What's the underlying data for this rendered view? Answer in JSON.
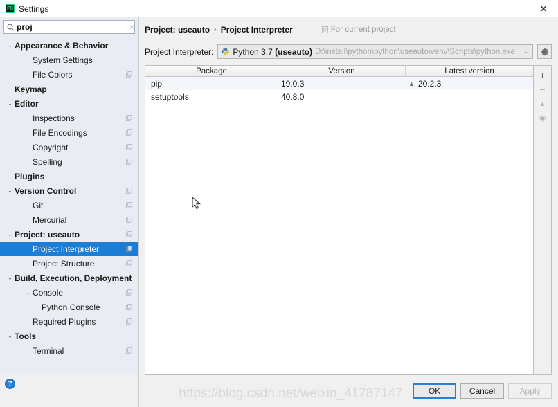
{
  "window": {
    "title": "Settings",
    "app_icon": "PC",
    "close_label": "✕"
  },
  "search": {
    "value": "proj",
    "placeholder": "",
    "clear_label": "×",
    "icon": "search-icon"
  },
  "sidebar": {
    "items": [
      {
        "label": "Appearance & Behavior",
        "depth": 0,
        "bold": true,
        "arrow": "⌄",
        "copy": false,
        "selected": false
      },
      {
        "label": "System Settings",
        "depth": 1,
        "bold": false,
        "arrow": "",
        "copy": false,
        "selected": false
      },
      {
        "label": "File Colors",
        "depth": 1,
        "bold": false,
        "arrow": "",
        "copy": true,
        "selected": false
      },
      {
        "label": "Keymap",
        "depth": 0,
        "bold": true,
        "arrow": "",
        "copy": false,
        "selected": false
      },
      {
        "label": "Editor",
        "depth": 0,
        "bold": true,
        "arrow": "⌄",
        "copy": false,
        "selected": false
      },
      {
        "label": "Inspections",
        "depth": 1,
        "bold": false,
        "arrow": "",
        "copy": true,
        "selected": false
      },
      {
        "label": "File Encodings",
        "depth": 1,
        "bold": false,
        "arrow": "",
        "copy": true,
        "selected": false
      },
      {
        "label": "Copyright",
        "depth": 1,
        "bold": false,
        "arrow": "",
        "copy": true,
        "selected": false
      },
      {
        "label": "Spelling",
        "depth": 1,
        "bold": false,
        "arrow": "",
        "copy": true,
        "selected": false
      },
      {
        "label": "Plugins",
        "depth": 0,
        "bold": true,
        "arrow": "",
        "copy": false,
        "selected": false
      },
      {
        "label": "Version Control",
        "depth": 0,
        "bold": true,
        "arrow": "⌄",
        "copy": true,
        "selected": false
      },
      {
        "label": "Git",
        "depth": 1,
        "bold": false,
        "arrow": "",
        "copy": true,
        "selected": false
      },
      {
        "label": "Mercurial",
        "depth": 1,
        "bold": false,
        "arrow": "",
        "copy": true,
        "selected": false
      },
      {
        "label": "Project: useauto",
        "depth": 0,
        "bold": true,
        "arrow": "⌄",
        "copy": true,
        "selected": false
      },
      {
        "label": "Project Interpreter",
        "depth": 1,
        "bold": false,
        "arrow": "",
        "copy": true,
        "selected": true
      },
      {
        "label": "Project Structure",
        "depth": 1,
        "bold": false,
        "arrow": "",
        "copy": true,
        "selected": false
      },
      {
        "label": "Build, Execution, Deployment",
        "depth": 0,
        "bold": true,
        "arrow": "⌄",
        "copy": false,
        "selected": false
      },
      {
        "label": "Console",
        "depth": 1,
        "bold": false,
        "arrow": "⌄",
        "copy": true,
        "selected": false
      },
      {
        "label": "Python Console",
        "depth": 2,
        "bold": false,
        "arrow": "",
        "copy": true,
        "selected": false
      },
      {
        "label": "Required Plugins",
        "depth": 1,
        "bold": false,
        "arrow": "",
        "copy": true,
        "selected": false
      },
      {
        "label": "Tools",
        "depth": 0,
        "bold": true,
        "arrow": "⌄",
        "copy": false,
        "selected": false
      },
      {
        "label": "Terminal",
        "depth": 1,
        "bold": false,
        "arrow": "",
        "copy": true,
        "selected": false
      }
    ],
    "help_label": "?"
  },
  "main": {
    "breadcrumb": {
      "parent": "Project: useauto",
      "separator": "›",
      "current": "Project Interpreter",
      "note": "For current project"
    },
    "interpreter": {
      "label": "Project Interpreter:",
      "name": "Python 3.7 (useauto)",
      "name_prefix": "Python 3.7 ",
      "name_project": "(useauto)",
      "path": "D:\\install\\python\\python\\useauto\\venv\\Scripts\\python.exe",
      "dropdown_arrow": "⌄",
      "gear_icon": "gear-icon"
    },
    "table": {
      "columns": [
        "Package",
        "Version",
        "Latest version"
      ],
      "rows": [
        {
          "package": "pip",
          "version": "19.0.3",
          "latest": "20.2.3",
          "upgradable": true
        },
        {
          "package": "setuptools",
          "version": "40.8.0",
          "latest": "",
          "upgradable": false
        }
      ],
      "side_buttons": [
        {
          "name": "add-package-button",
          "glyph": "+",
          "dim": false
        },
        {
          "name": "remove-package-button",
          "glyph": "−",
          "dim": true
        },
        {
          "name": "upgrade-package-button",
          "glyph": "▲",
          "dim": true
        },
        {
          "name": "show-early-releases-button",
          "glyph": "◉",
          "dim": true
        }
      ],
      "upgrade_marker": "▲"
    }
  },
  "footer": {
    "ok_label": "OK",
    "cancel_label": "Cancel",
    "apply_label": "Apply"
  },
  "watermark": {
    "text": "https://blog.csdn.net/weixin_41787147"
  },
  "colors": {
    "accent": "#1a7ed6",
    "sidebar_bg": "#e9edf3",
    "selection_bg": "#1a7ed6",
    "default_button_border": "#2a7fd4",
    "help_blue": "#2a7fd4"
  }
}
